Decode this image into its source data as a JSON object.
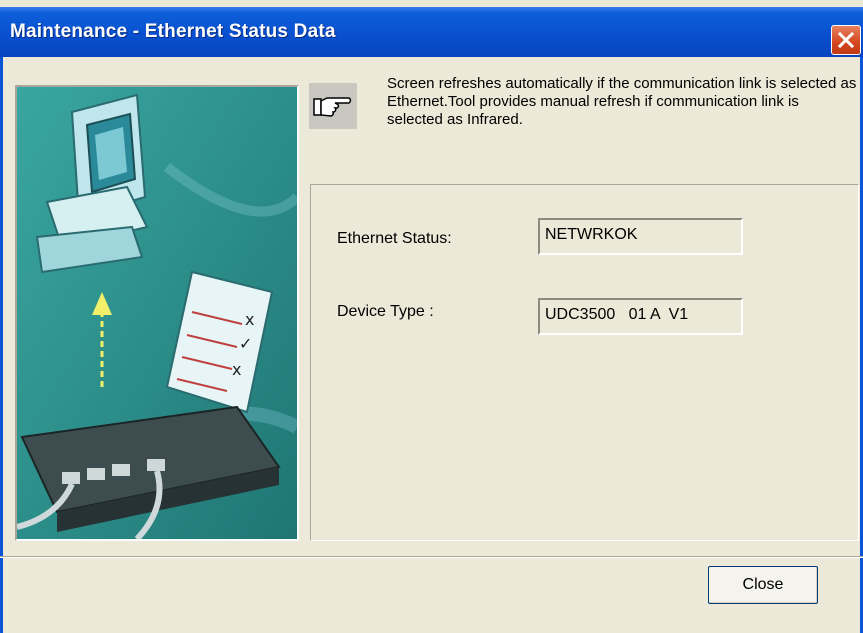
{
  "window": {
    "title": "Maintenance - Ethernet Status Data"
  },
  "info": {
    "text": "Screen refreshes automatically if the communication link is selected as Ethernet.Tool provides manual refresh if communication link is selected as Infrared."
  },
  "status": {
    "ethernet_label": "Ethernet Status:",
    "ethernet_value": "NETWRKOK",
    "device_label": "Device Type :",
    "device_value": "UDC3500   01 A  V1"
  },
  "buttons": {
    "close_label": "Close"
  },
  "icons": {
    "title_close": "close-icon",
    "hint": "pointing-hand-icon",
    "illustration": "network-illustration"
  },
  "colors": {
    "titlebar": "#0950d0",
    "window_bg": "#ece9d8",
    "close_button": "#d4461e",
    "illustration_bg": "#2d8f8a"
  }
}
